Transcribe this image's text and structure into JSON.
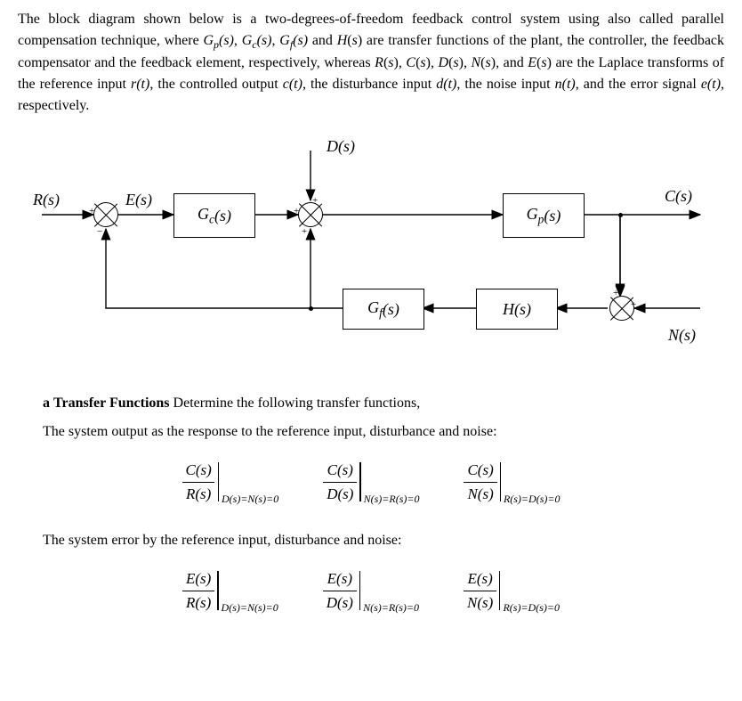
{
  "intro": {
    "part1": "The block diagram shown below is a two-degrees-of-freedom feedback control system using also called parallel compensation technique, where ",
    "funcs": "G_p(s), G_c(s), G_f(s) and H(s)",
    "part2": " are transfer functions of the plant, the controller, the feedback compensator and the feedback element, respectively, whereas ",
    "sigs": "R(s), C(s), D(s), N(s), and E(s)",
    "part3": " are the Laplace transforms of the reference input ",
    "r": "r(t)",
    "part4": ", the controlled output ",
    "c": "c(t)",
    "part5": ", the disturbance input ",
    "d": "d(t)",
    "part6": ", the noise input ",
    "n": "n(t)",
    "part7": ", and the error signal ",
    "e": "e(t)",
    "part8": ", respectively."
  },
  "diagram": {
    "R": "R(s)",
    "E": "E(s)",
    "D": "D(s)",
    "C": "C(s)",
    "N": "N(s)",
    "Gc": "G_c(s)",
    "Gp": "G_p(s)",
    "Gf": "G_f(s)",
    "H": "H(s)",
    "plus": "+"
  },
  "partA": {
    "letter": "a",
    "title": "Transfer Functions",
    "desc": "Determine the following transfer functions,",
    "line1": "The system output as the response to the reference input, disturbance and noise:",
    "line2": "The system error by the reference input, disturbance and noise:"
  },
  "tf": {
    "C": "C(s)",
    "E": "E(s)",
    "R": "R(s)",
    "D": "D(s)",
    "N": "N(s)",
    "cond_DN": "D(s)=N(s)=0",
    "cond_NR": "N(s)=R(s)=0",
    "cond_RD": "R(s)=D(s)=0"
  },
  "chart_data": {
    "type": "block-diagram",
    "blocks": [
      {
        "name": "Gc",
        "label": "G_c(s)"
      },
      {
        "name": "Gp",
        "label": "G_p(s)"
      },
      {
        "name": "Gf",
        "label": "G_f(s)"
      },
      {
        "name": "H",
        "label": "H(s)"
      }
    ],
    "summing_junctions": [
      {
        "name": "sum1",
        "inputs": [
          "R(+)",
          "feedback(-)"
        ],
        "output": "E"
      },
      {
        "name": "sum2",
        "inputs": [
          "Gc(+)",
          "D(+)",
          "Gf(+)"
        ],
        "output": "to Gp"
      },
      {
        "name": "sum3",
        "inputs": [
          "C(+)",
          "N(+)"
        ],
        "output": "to H"
      }
    ],
    "signals": {
      "R": "R(s) reference input",
      "E": "E(s) error signal",
      "D": "D(s) disturbance input",
      "C": "C(s) controlled output",
      "N": "N(s) noise input"
    },
    "connections": [
      "R -> sum1",
      "sum1 -> Gc (label E)",
      "Gc -> sum2",
      "D -> sum2",
      "sum2 -> Gp",
      "Gp -> C (output)",
      "C branch -> sum3",
      "N -> sum3",
      "sum3 -> H",
      "H -> Gf",
      "Gf -> sum2",
      "Gf branch -> sum1 (feedback)"
    ]
  }
}
